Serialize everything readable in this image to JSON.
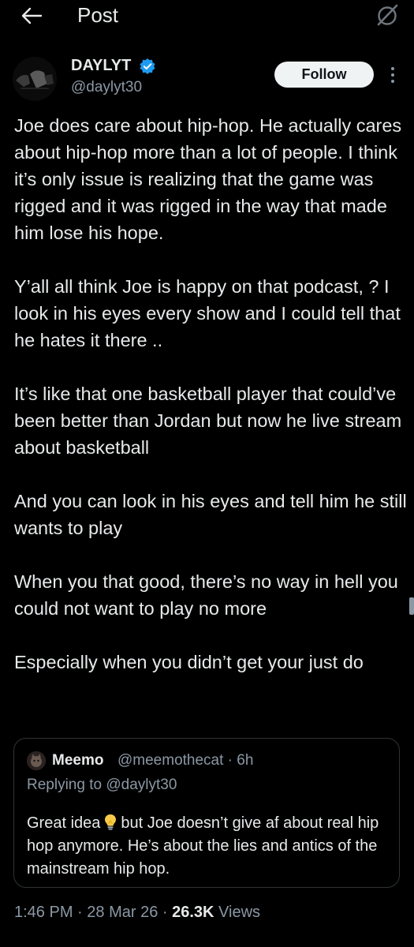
{
  "header": {
    "title": "Post"
  },
  "post": {
    "author": {
      "name": "DAYLYT",
      "handle": "@daylyt30",
      "verified": true
    },
    "follow_label": "Follow",
    "paragraphs": [
      "Joe does care about hip-hop. He actually cares about hip-hop more than a lot of people. I think it’s only issue is realizing that the game was rigged and it was rigged in the way that made him lose his hope.",
      "Y’all all think Joe is happy on that podcast, ? I  look in his eyes every show and I could tell that he hates it there ..",
      "It’s like that one basketball player that could’ve been better than Jordan but now he live stream about basketball",
      "And you can look in his eyes and tell him he still wants to play",
      "When you that good, there’s no way in hell you could not want to play no more",
      "Especially when you didn’t get your just do"
    ],
    "meta": {
      "time": "1:46 PM",
      "sep1": " · ",
      "date": "28 Mar 26",
      "sep2": " · ",
      "views_count": "26.3K",
      "views_label": " Views"
    }
  },
  "quote": {
    "name": "Meemo",
    "handle": "@meemothecat",
    "time": " · 6h",
    "replying_to": "Replying to @daylyt30",
    "text_before": "Great idea",
    "text_after": "but Joe doesn’t give af about real hip hop anymore. He’s about the lies and antics of the mainstream hip hop."
  },
  "icons": {
    "back": "arrow-left-icon",
    "grok": "grok-icon",
    "verified": "verified-badge-icon",
    "more": "more-vertical-icon",
    "bulb": "light-bulb-emoji"
  },
  "colors": {
    "background": "#000000",
    "text": "#e7e9ea",
    "secondary": "#8b98a5",
    "verified": "#1d9bf0",
    "border": "#2f3336"
  }
}
